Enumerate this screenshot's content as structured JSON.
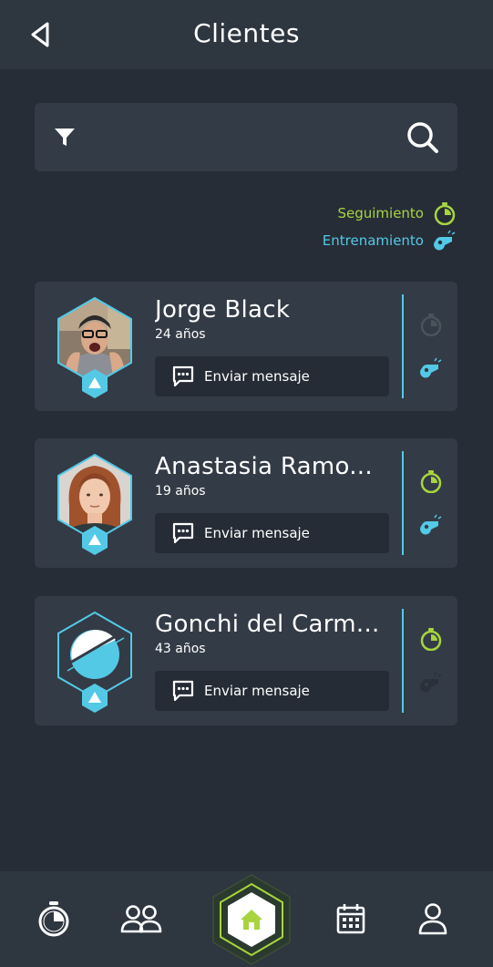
{
  "header": {
    "title": "Clientes",
    "back_icon": "back-triangle-icon"
  },
  "search": {
    "filter_icon": "filter-icon",
    "search_icon": "search-icon"
  },
  "legend": {
    "seguimiento_label": "Seguimiento",
    "entrenamiento_label": "Entrenamiento",
    "seguimiento_color": "#a7d43f",
    "entrenamiento_color": "#54c9e6"
  },
  "clients": [
    {
      "name": "Jorge Black",
      "age": "24 años",
      "message_label": "Enviar mensaje",
      "seguimiento_active": false,
      "entrenamiento_active": true
    },
    {
      "name": "Anastasia Ramo...",
      "age": "19 años",
      "message_label": "Enviar mensaje",
      "seguimiento_active": true,
      "entrenamiento_active": true
    },
    {
      "name": "Gonchi del Carm...",
      "age": "43 años",
      "message_label": "Enviar mensaje",
      "seguimiento_active": true,
      "entrenamiento_active": false
    }
  ],
  "bottom_nav": {
    "items": [
      "stopwatch-icon",
      "clients-icon",
      "home-icon",
      "calendar-icon",
      "profile-icon"
    ],
    "active": "home-icon"
  },
  "colors": {
    "background": "#262d37",
    "surface": "#333b46",
    "header": "#2e3640",
    "accent_green": "#a7d43f",
    "accent_blue": "#54c9e6",
    "inactive": "#4a525c"
  }
}
